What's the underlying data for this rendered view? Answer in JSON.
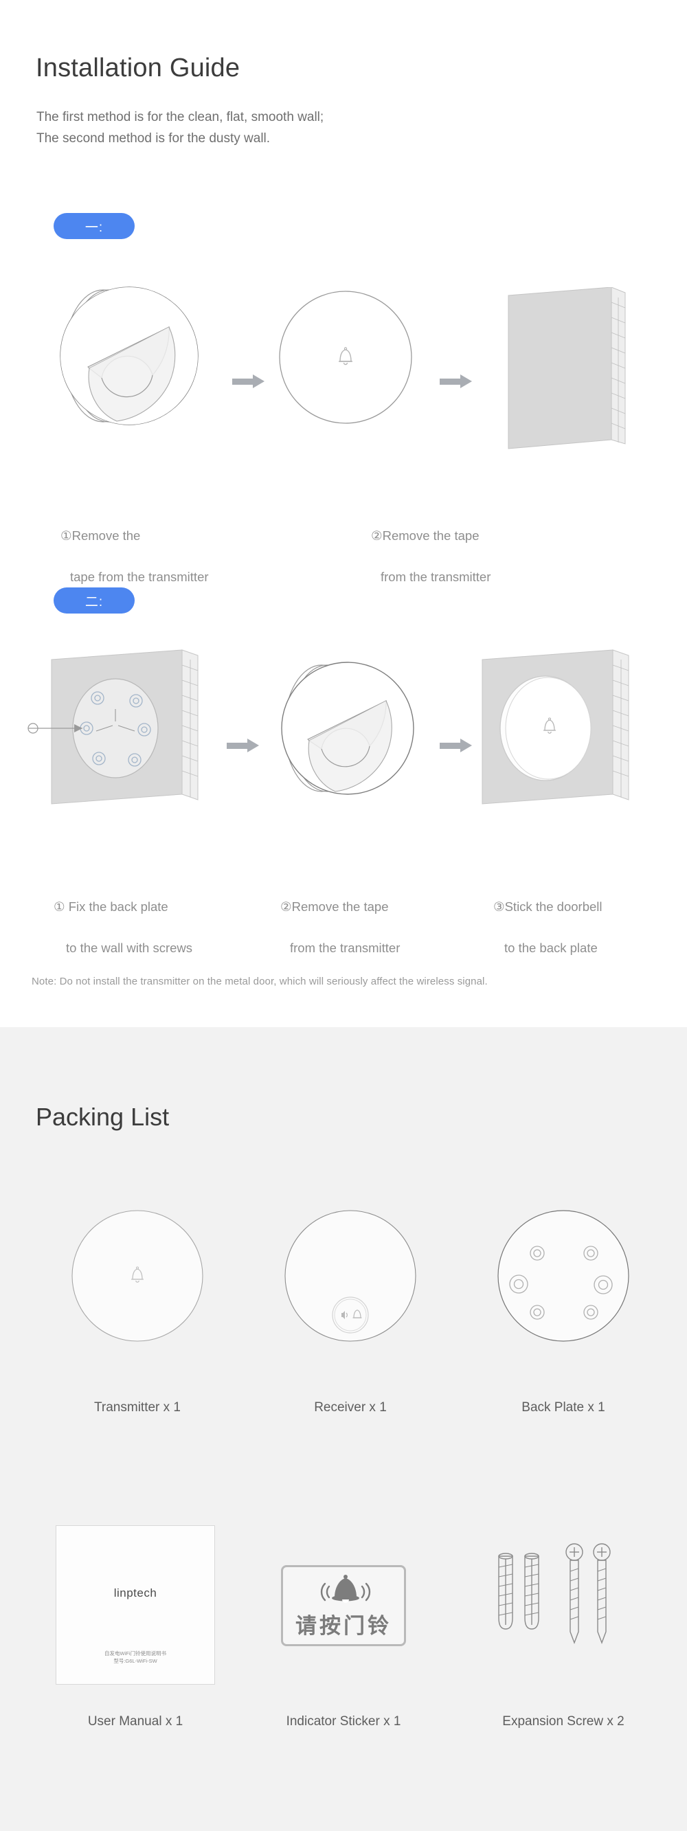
{
  "install": {
    "title": "Installation Guide",
    "subtitle_line1": "The first method is for the clean, flat, smooth wall;",
    "subtitle_line2": "The second method is for the dusty wall.",
    "method1_badge": "一:",
    "method2_badge": "二:",
    "method1_steps": [
      {
        "num": "①",
        "line1": "Remove the",
        "line2": "tape from the transmitter"
      },
      {
        "num": "②",
        "line1": "Remove the tape",
        "line2": "from the transmitter"
      }
    ],
    "method2_steps": [
      {
        "num": "①",
        "line1": " Fix the back plate",
        "line2": "to the wall with screws"
      },
      {
        "num": "②",
        "line1": "Remove the tape",
        "line2": "from the transmitter"
      },
      {
        "num": "③",
        "line1": "Stick the doorbell",
        "line2": "to the back plate"
      }
    ],
    "note": "Note: Do not install the transmitter on the metal door, which will seriously affect the wireless signal."
  },
  "packing": {
    "title": "Packing List",
    "items_row1": [
      {
        "label": "Transmitter x 1",
        "icon": "doorbell-circle-icon"
      },
      {
        "label": "Receiver x 1",
        "icon": "receiver-circle-icon"
      },
      {
        "label": "Back Plate x 1",
        "icon": "back-plate-icon"
      }
    ],
    "items_row2": [
      {
        "label": "User Manual x 1",
        "icon": "manual-booklet-icon"
      },
      {
        "label": "Indicator Sticker x 1",
        "icon": "doorbell-sticker-icon"
      },
      {
        "label": "Expansion Screw x 2",
        "icon": "expansion-screw-icon"
      }
    ],
    "manual": {
      "brand": "linptech",
      "sub_line1": "自发电WiFi门铃使用说明书",
      "sub_line2": "型号:G6L-WiFi-SW"
    },
    "sticker": {
      "text": "请按门铃",
      "bell_icon": "ringing-bell-icon"
    }
  },
  "colors": {
    "badge_blue": "#4d86f0",
    "arrow_gray": "#a9adb3",
    "panel_bg": "#f2f2f2",
    "title_text": "#3c3c3c",
    "body_text": "#6f6f6f",
    "caption_text": "#8e8e8e"
  }
}
